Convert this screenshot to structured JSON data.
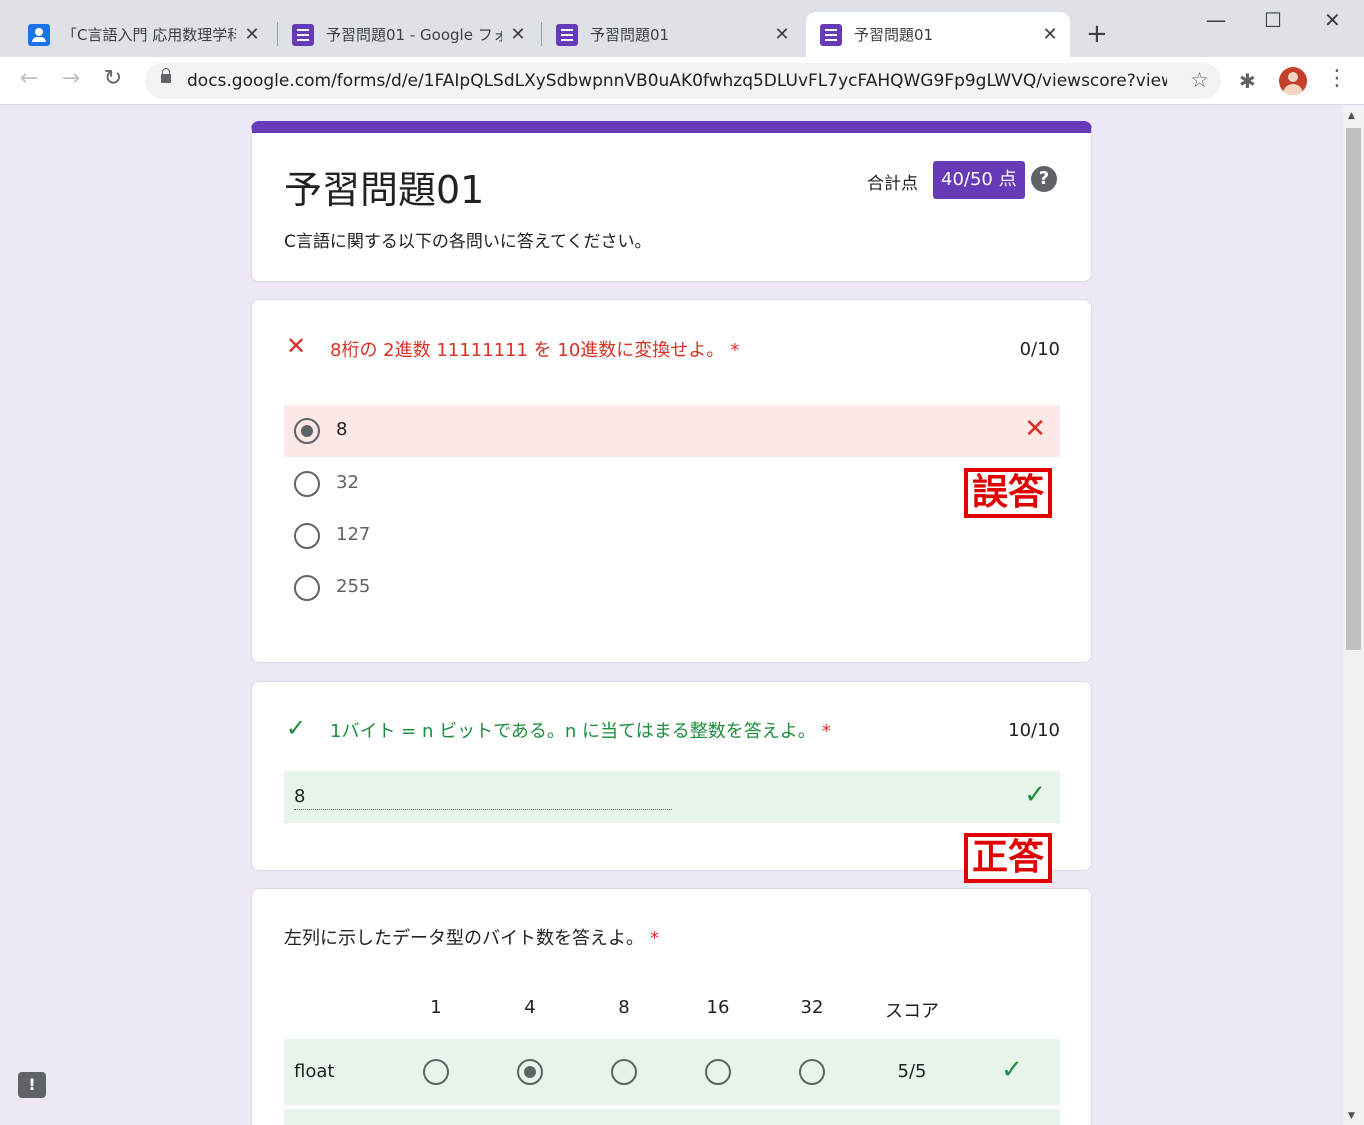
{
  "browser": {
    "tabs": [
      {
        "title": "「C言語入門 応用数理学科",
        "close": "✕"
      },
      {
        "title": "予習問題01 - Google フォー",
        "close": "✕"
      },
      {
        "title": "予習問題01",
        "close": "✕"
      },
      {
        "title": "予習問題01",
        "close": "✕"
      }
    ],
    "new_tab": "+",
    "window": {
      "minimize": "—",
      "maximize": "☐",
      "close": "✕"
    },
    "nav": {
      "back": "←",
      "forward": "→",
      "reload": "↻"
    },
    "url": "docs.google.com/forms/d/e/1FAIpQLSdLXySdbwpnnVB0uAK0fwhzq5DLUvFL7ycFAHQWG9Fp9gLWVQ/viewscore?views...",
    "bookmark": "☆",
    "extensions": "✱",
    "menu": "⋮"
  },
  "form": {
    "title": "予習問題01",
    "description": "C言語に関する以下の各問いに答えてください。",
    "score_label": "合計点",
    "score_value": "40/50 点",
    "help": "?"
  },
  "q1": {
    "mark": "✕",
    "text": "8桁の 2進数 11111111 を 10進数に変換せよ。",
    "required": "*",
    "points": "0/10",
    "options": [
      "8",
      "32",
      "127",
      "255"
    ],
    "selected_mark": "✕",
    "stamp": "誤答"
  },
  "q2": {
    "mark": "✓",
    "text": "1バイト = n ビットである。n に当てはまる整数を答えよ。",
    "required": "*",
    "points": "10/10",
    "answer": "8",
    "answer_mark": "✓",
    "stamp": "正答"
  },
  "q3": {
    "text": "左列に示したデータ型のバイト数を答えよ。",
    "required": "*",
    "columns": [
      "1",
      "4",
      "8",
      "16",
      "32"
    ],
    "score_header": "スコア",
    "rows": [
      {
        "label": "float",
        "selected": "4",
        "score": "5/5",
        "mark": "✓"
      }
    ]
  },
  "feedback": "!",
  "colors": {
    "accent": "#673ab7",
    "background": "#ede7f6",
    "wrong": "#d93025",
    "right": "#1e8e3e",
    "stamp": "#e00000"
  }
}
